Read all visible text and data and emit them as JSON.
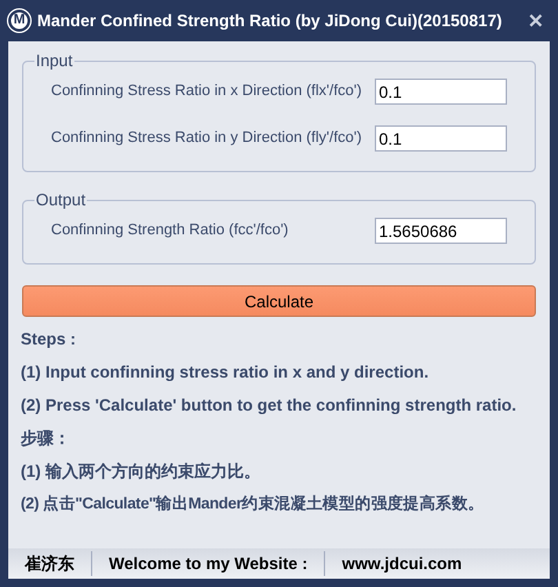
{
  "window": {
    "icon_letter": "M",
    "title": "Mander Confined Strength Ratio (by JiDong Cui)(20150817)",
    "close": "✕"
  },
  "input_group": {
    "title": "Input",
    "fields": [
      {
        "label": "Confinning Stress Ratio in x Direction (flx'/fco')",
        "value": "0.1"
      },
      {
        "label": "Confinning Stress Ratio in y Direction (fly'/fco')",
        "value": "0.1"
      }
    ]
  },
  "output_group": {
    "title": "Output",
    "fields": [
      {
        "label": "Confinning Strength Ratio (fcc'/fco')",
        "value": "1.5650686"
      }
    ]
  },
  "calculate_button": "Calculate",
  "steps": [
    "Steps :",
    "(1) Input confinning stress ratio in x and y direction.",
    "(2) Press 'Calculate' button to get the confinning strength ratio.",
    "步骤：",
    "(1) 输入两个方向的约束应力比。",
    "(2) 点击\"Calculate\"输出Mander约束混凝土模型的强度提高系数。"
  ],
  "status_bar": [
    "崔济东",
    "Welcome to my Website :",
    "www.jdcui.com"
  ]
}
